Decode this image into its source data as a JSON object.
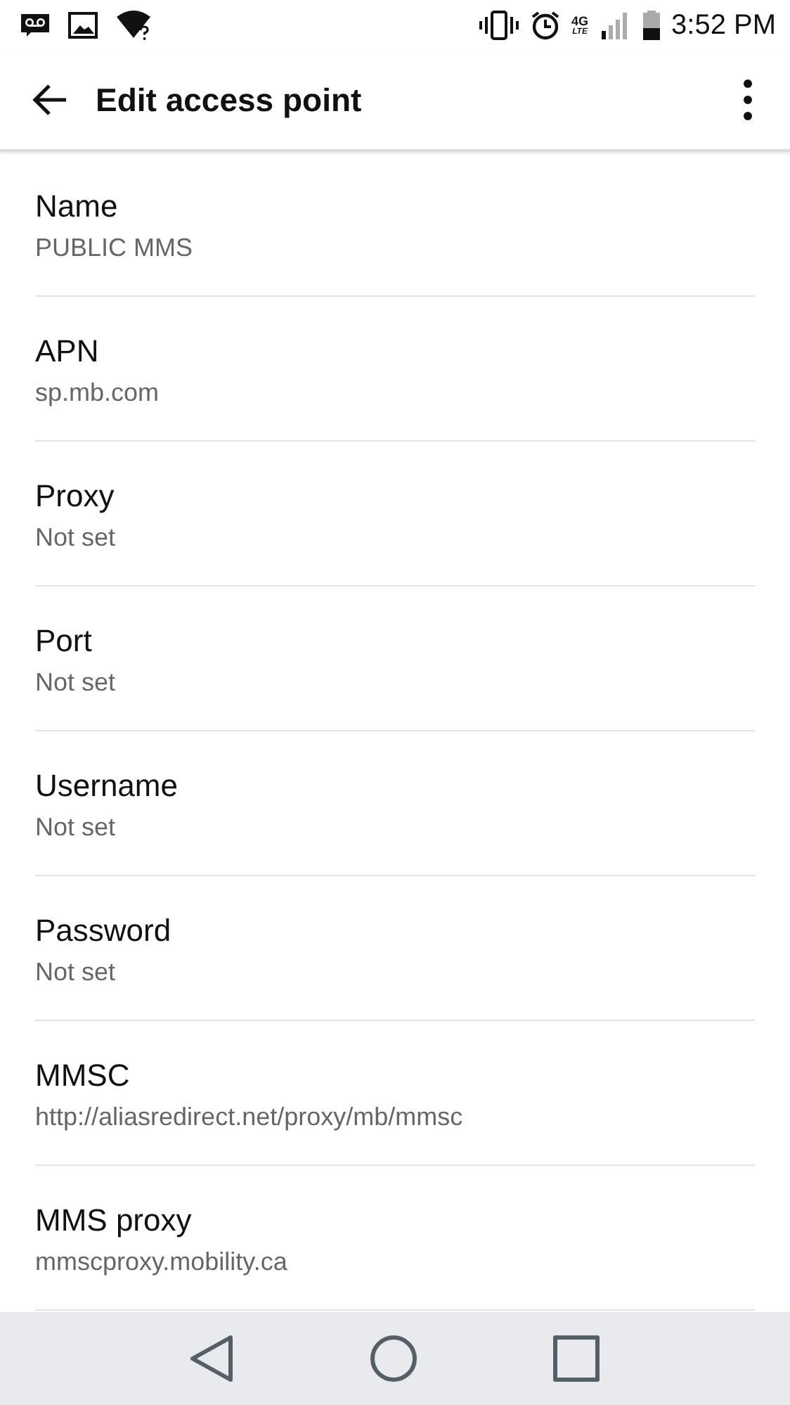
{
  "status_bar": {
    "network_type": "4G",
    "network_sub": "LTE",
    "time": "3:52 PM"
  },
  "app_bar": {
    "title": "Edit access point"
  },
  "settings": [
    {
      "label": "Name",
      "value": "PUBLIC MMS"
    },
    {
      "label": "APN",
      "value": "sp.mb.com"
    },
    {
      "label": "Proxy",
      "value": "Not set"
    },
    {
      "label": "Port",
      "value": "Not set"
    },
    {
      "label": "Username",
      "value": "Not set"
    },
    {
      "label": "Password",
      "value": "Not set"
    },
    {
      "label": "MMSC",
      "value": "http://aliasredirect.net/proxy/mb/mmsc"
    },
    {
      "label": "MMS proxy",
      "value": "mmscproxy.mobility.ca"
    }
  ]
}
